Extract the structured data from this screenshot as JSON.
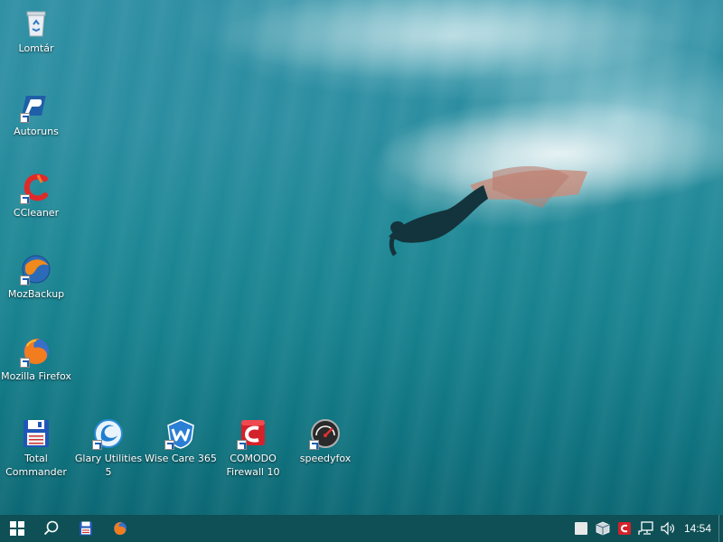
{
  "desktop": {
    "icons": [
      {
        "label": "Lomtár",
        "icon": "recycle-bin-icon"
      },
      {
        "label": "Autoruns",
        "icon": "autoruns-icon"
      },
      {
        "label": "CCleaner",
        "icon": "ccleaner-icon"
      },
      {
        "label": "MozBackup",
        "icon": "mozbackup-icon"
      },
      {
        "label": "Mozilla Firefox",
        "icon": "firefox-icon"
      },
      {
        "label": "Total Commander",
        "icon": "total-commander-icon"
      },
      {
        "label": "Glary Utilities 5",
        "icon": "glary-utilities-icon"
      },
      {
        "label": "Wise Care 365",
        "icon": "wise-care-icon"
      },
      {
        "label": "COMODO Firewall 10",
        "icon": "comodo-firewall-icon"
      },
      {
        "label": "speedyfox",
        "icon": "speedyfox-icon"
      }
    ]
  },
  "taskbar": {
    "start": "windows-start-icon",
    "search": "search-icon",
    "pinned": [
      "total-commander-icon",
      "firefox-icon"
    ],
    "tray": [
      "white-square-icon",
      "box-icon",
      "comodo-tray-icon",
      "network-icon",
      "volume-icon"
    ],
    "clock": "14:54"
  },
  "colors": {
    "taskbar": "#0e5056",
    "water_top": "#2f8fa4",
    "water_bottom": "#0c6874"
  }
}
